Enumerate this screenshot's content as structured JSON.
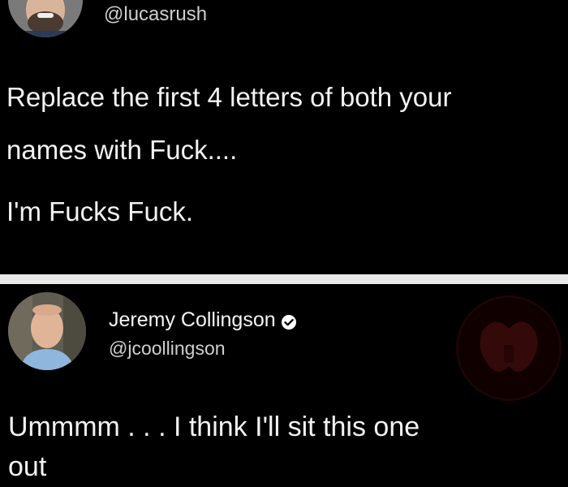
{
  "tweet1": {
    "handle": "@lucasrush",
    "lines": [
      "Replace the first 4 letters of both your",
      "names with Fuck....",
      "I'm Fucks Fuck."
    ]
  },
  "tweet2": {
    "display_name": "Jeremy Collingson",
    "handle": "@jcoollingson",
    "lines": [
      "Ummmm . . . I think I'll sit this one",
      "out"
    ]
  },
  "colors": {
    "background": "#000000",
    "divider": "#e9e9e9",
    "verified_badge": "#ffffff"
  },
  "icons": {
    "verified": "verified-check-icon",
    "watermark": "watermark-logo"
  }
}
